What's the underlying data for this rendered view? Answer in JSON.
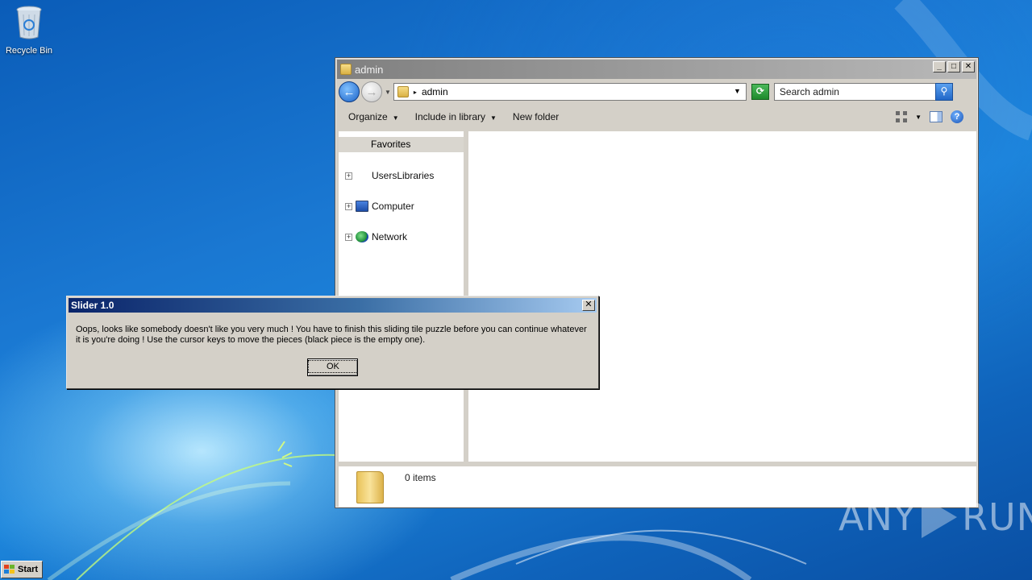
{
  "desktop": {
    "icons": [
      {
        "label": "Recycle Bin",
        "icon": "recycle-bin-icon"
      }
    ],
    "watermark": {
      "left": "ANY",
      "right": "RUN"
    }
  },
  "explorer": {
    "title": "admin",
    "address": "admin",
    "search_placeholder": "Search admin",
    "commands": {
      "organize": "Organize",
      "include": "Include in library",
      "new_folder": "New folder"
    },
    "nav": {
      "favorites": "Favorites",
      "items": [
        "UsersLibraries",
        "Computer",
        "Network"
      ]
    },
    "status": {
      "items": "0 items"
    }
  },
  "dialog": {
    "title": "Slider 1.0",
    "message": "Oops, looks like somebody doesn't like you very much ! You have to finish this sliding tile puzzle before you can continue whatever it is you're doing ! Use the cursor keys to move the pieces (black piece is the empty one).",
    "ok_label": "OK"
  },
  "taskbar": {
    "start_label": "Start"
  }
}
